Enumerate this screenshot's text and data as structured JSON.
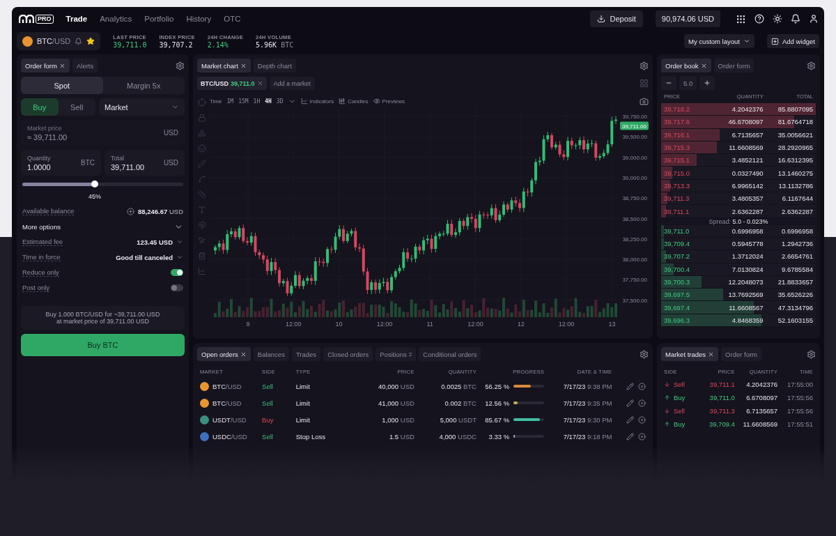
{
  "nav": {
    "logo_badge": "PRO",
    "items": [
      {
        "label": "Trade",
        "selected": true
      },
      {
        "label": "Analytics",
        "selected": false
      },
      {
        "label": "Portfolio",
        "selected": false
      },
      {
        "label": "History",
        "selected": false
      },
      {
        "label": "OTC",
        "selected": false
      }
    ],
    "deposit": "Deposit",
    "balance": "90,974.06 USD"
  },
  "ticker": {
    "base": "BTC",
    "quote": "/USD",
    "favorite": true,
    "stats": [
      {
        "label": "LAST PRICE",
        "value": "39,711.0",
        "positive": true
      },
      {
        "label": "INDEX PRICE",
        "value": "39,707.2",
        "positive": false
      },
      {
        "label": "24H CHANGE",
        "value": "2.14%",
        "positive": true
      },
      {
        "label": "24H VOLUME",
        "value": "5.96K",
        "unit": "BTC",
        "positive": false
      }
    ],
    "layout": "My custom layout",
    "add_widget": "Add widget"
  },
  "order_form": {
    "tabs": [
      {
        "label": "Order form",
        "selected": true
      },
      {
        "label": "Alerts",
        "selected": false
      }
    ],
    "modes": [
      {
        "label": "Spot",
        "selected": true
      },
      {
        "label": "Margin 5x",
        "selected": false
      }
    ],
    "sides": [
      {
        "label": "Buy",
        "selected": true
      },
      {
        "label": "Sell",
        "selected": false
      }
    ],
    "order_type": "Market",
    "market_price": {
      "label": "Market price",
      "value": "≈ 39,711.00",
      "unit": "USD",
      "disabled": true
    },
    "quantity": {
      "label": "Quantity",
      "value": "1.0000",
      "unit": "BTC"
    },
    "total": {
      "label": "Total",
      "value": "39,711.00",
      "unit": "USD"
    },
    "slider": {
      "level": 0.45,
      "reading": "45%"
    },
    "options": [
      {
        "kind": "balance",
        "label": "Available balance",
        "value": "88,246.67",
        "unit": "USD"
      },
      {
        "kind": "expander",
        "label": "More options"
      },
      {
        "kind": "select",
        "label": "Estimated fee",
        "value": "123.45 USD"
      },
      {
        "kind": "select",
        "label": "Time in force",
        "value": "Good till canceled"
      },
      {
        "kind": "toggle",
        "label": "Reduce only",
        "on": true
      },
      {
        "kind": "toggle",
        "label": "Post only",
        "on": false
      }
    ],
    "summary": [
      "Buy 1.000 BTC/USD for ~39,711.00 USD",
      "at market price of 39,711.00 USD"
    ],
    "submit": "Buy BTC"
  },
  "chart": {
    "tabs": [
      {
        "label": "Market chart",
        "selected": true
      },
      {
        "label": "Depth chart",
        "selected": false
      }
    ],
    "market": {
      "pair": "BTC/USD",
      "price": "39,711.0"
    },
    "add_market": "Add a market",
    "interval_label": "Time",
    "intervals": [
      {
        "label": "1M",
        "selected": false
      },
      {
        "label": "15M",
        "selected": false
      },
      {
        "label": "1H",
        "selected": false
      },
      {
        "label": "4H",
        "selected": true
      },
      {
        "label": "3D",
        "selected": false
      }
    ],
    "tools": [
      "Indicators",
      "Candles",
      "Previews"
    ],
    "y_labels": [
      "39,750.00",
      "39,500.00",
      "39,000.00",
      "39,000.00",
      "38,750.00",
      "38,500.00",
      "38,250.00",
      "38,000.00",
      "37,750.00",
      "37,500.00"
    ],
    "x_labels": [
      "9",
      "12:00",
      "10",
      "12:00",
      "11",
      "12:00",
      "12",
      "12:00",
      "13"
    ],
    "price_tag": "39,711.00"
  },
  "order_book": {
    "tabs": [
      {
        "label": "Order book",
        "selected": true
      },
      {
        "label": "Order form",
        "selected": false
      }
    ],
    "step": "5.0",
    "columns": [
      "PRICE",
      "QUANTITY",
      "TOTAL"
    ],
    "asks": [
      {
        "price": "39,718.2",
        "quantity": "4.2042376",
        "total": "85.8807095",
        "level": 1
      },
      {
        "price": "39,717.6",
        "quantity": "46.6708097",
        "total": "81.6764718",
        "level": 0.86
      },
      {
        "price": "39,716.1",
        "quantity": "6.7135657",
        "total": "35.0056621",
        "level": 0.38
      },
      {
        "price": "39,715.3",
        "quantity": "11.6608569",
        "total": "28.2920965",
        "level": 0.36
      },
      {
        "price": "39,715.1",
        "quantity": "3.4852121",
        "total": "16.6312395",
        "level": 0.23
      },
      {
        "price": "39,715.0",
        "quantity": "0.0327490",
        "total": "13.1460275",
        "level": 0.07
      },
      {
        "price": "39,713.3",
        "quantity": "6.9965142",
        "total": "13.1132786",
        "level": 0.06
      },
      {
        "price": "39,711.3",
        "quantity": "3.4805357",
        "total": "6.1167644",
        "level": 0.04
      },
      {
        "price": "39,711.1",
        "quantity": "2.6362287",
        "total": "2.6362287",
        "level": 0.03
      }
    ],
    "spread_label": "Spread:",
    "spread": "5.0 - 0.023%",
    "bids": [
      {
        "price": "39,711.0",
        "quantity": "0.6996958",
        "total": "0.6996958",
        "level": 0.02
      },
      {
        "price": "39,709.4",
        "quantity": "0.5945778",
        "total": "1.2942736",
        "level": 0.02
      },
      {
        "price": "39,707.2",
        "quantity": "1.3712024",
        "total": "2.6654761",
        "level": 0.03
      },
      {
        "price": "39,700.4",
        "quantity": "7.0130824",
        "total": "9.6785584",
        "level": 0.08
      },
      {
        "price": "39,700.3",
        "quantity": "12.2048073",
        "total": "21.8833657",
        "level": 0.26
      },
      {
        "price": "39,697.5",
        "quantity": "13.7692569",
        "total": "35.6526226",
        "level": 0.4
      },
      {
        "price": "39,697.4",
        "quantity": "11.6608567",
        "total": "47.3134796",
        "level": 0.6
      },
      {
        "price": "39,696.3",
        "quantity": "4.8468359",
        "total": "52.1603155",
        "level": 0.65
      }
    ]
  },
  "orders": {
    "tabs": [
      {
        "label": "Open orders",
        "selected": true
      },
      {
        "label": "Balances",
        "selected": false
      },
      {
        "label": "Trades",
        "selected": false
      },
      {
        "label": "Closed orders",
        "selected": false
      },
      {
        "label": "Positions",
        "selected": false,
        "count": "2"
      },
      {
        "label": "Conditional orders",
        "selected": false
      }
    ],
    "columns": [
      "MARKET",
      "SIDE",
      "TYPE",
      "PRICE",
      "QUANTITY",
      "PROGRESS",
      "DATE & TIME"
    ],
    "rows": [
      {
        "base": "BTC",
        "quote": "/USD",
        "coin": {
          "color": "#e8952f"
        },
        "side": "Sell",
        "sell": true,
        "type": "Limit",
        "price": "40,000",
        "price_unit": "USD",
        "quantity": "0.0025",
        "quantity_unit": "BTC",
        "progress": "56.25 %",
        "bar": {
          "level": 0.5625,
          "color": "#d98a3a"
        },
        "date": "7/17/23",
        "time": "9:38 PM"
      },
      {
        "base": "BTC",
        "quote": "/USD",
        "coin": {
          "color": "#e8952f"
        },
        "side": "Sell",
        "sell": true,
        "type": "Limit",
        "price": "41,000",
        "price_unit": "USD",
        "quantity": "0.002",
        "quantity_unit": "BTC",
        "progress": "12.56 %",
        "bar": {
          "level": 0.1256,
          "color": "#c9b24a"
        },
        "date": "7/17/23",
        "time": "9:35 PM"
      },
      {
        "base": "USDT",
        "quote": "/USD",
        "coin": {
          "color": "#3b8f7e"
        },
        "side": "Buy",
        "sell": false,
        "type": "Limit",
        "price": "1,000",
        "price_unit": "USD",
        "quantity": "5,000",
        "quantity_unit": "USDT",
        "progress": "85.67 %",
        "bar": {
          "level": 0.8567,
          "color": "#3fbf9f"
        },
        "date": "7/17/23",
        "time": "9:30 PM"
      },
      {
        "base": "USDC",
        "quote": "/USD",
        "coin": {
          "color": "#3f6fbf"
        },
        "side": "Sell",
        "sell": true,
        "type": "Stop Loss",
        "price": "1.5",
        "price_unit": "USD",
        "quantity": "4,000",
        "quantity_unit": "USDC",
        "progress": "3.33 %",
        "bar": {
          "level": 0.0333,
          "color": "#a8a6b8"
        },
        "date": "7/17/23",
        "time": "9:18 PM"
      }
    ]
  },
  "trades": {
    "tabs": [
      {
        "label": "Market trades",
        "selected": true
      },
      {
        "label": "Order form",
        "selected": false
      }
    ],
    "columns": [
      "SIDE",
      "PRICE",
      "QUANTITY",
      "TIME"
    ],
    "rows": [
      {
        "side": "Sell",
        "kind": "sell",
        "price": "39,711.1",
        "quantity": "4.2042376",
        "time": "17:55:00"
      },
      {
        "side": "Buy",
        "kind": "buy",
        "price": "39,711.0",
        "quantity": "6.6708097",
        "time": "17:55:56"
      },
      {
        "side": "Sell",
        "kind": "sell",
        "price": "39,711.3",
        "quantity": "6.7135657",
        "time": "17:55:56"
      },
      {
        "side": "Buy",
        "kind": "buy",
        "price": "39,709.4",
        "quantity": "11.6608569",
        "time": "17:55:51"
      }
    ]
  }
}
